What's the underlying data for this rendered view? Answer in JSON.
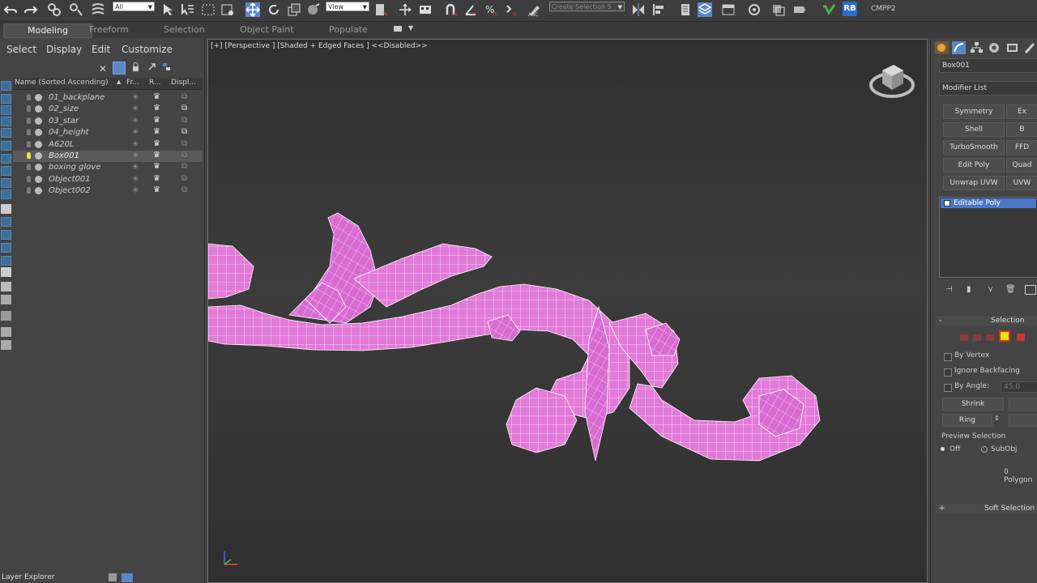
{
  "toolbar": {
    "filter_value": "All",
    "refcoord_value": "View",
    "selection_set_placeholder": "Create Selection S",
    "rb_badge": "RB",
    "right_label": "CMPP2"
  },
  "ribbon": {
    "tabs": [
      "Modeling",
      "Freeform",
      "Selection",
      "Object Paint",
      "Populate"
    ],
    "active_tab": "Modeling"
  },
  "explorer": {
    "menus": [
      "Select",
      "Display",
      "Edit",
      "Customize"
    ],
    "columns": [
      "Name (Sorted Ascending)",
      "Fr...",
      "R...",
      "Displ..."
    ],
    "objects": [
      {
        "name": "01_backplane",
        "selected": false
      },
      {
        "name": "02_size",
        "selected": false
      },
      {
        "name": "03_star",
        "selected": false
      },
      {
        "name": "04_height",
        "selected": false
      },
      {
        "name": "A620L",
        "selected": false
      },
      {
        "name": "Box001",
        "selected": true
      },
      {
        "name": "boxing glove",
        "selected": false
      },
      {
        "name": "Object001",
        "selected": false
      },
      {
        "name": "Object002",
        "selected": false
      }
    ],
    "layer_label": "Layer Explorer"
  },
  "viewport": {
    "label": "[+] [Perspective ] [Shaded + Edged Faces ]  <<Disabled>>",
    "mesh_color": "#e879e0"
  },
  "command_panel": {
    "object_name": "Box001",
    "modifier_list": "Modifier List",
    "modifier_buttons": [
      [
        "Symmetry",
        "Ex"
      ],
      [
        "Shell",
        "B"
      ],
      [
        "TurboSmooth",
        "FFD"
      ],
      [
        "Edit Poly",
        "Quad"
      ],
      [
        "Unwrap UVW",
        "UVW"
      ]
    ],
    "stack_item": "Editable Poly",
    "selection_rollout": "Selection",
    "by_vertex": "By Vertex",
    "ignore_backfacing": "Ignore Backfacing",
    "by_angle": "By Angle:",
    "by_angle_value": "45,0",
    "shrink": "Shrink",
    "ring": "Ring",
    "preview_selection": "Preview Selection",
    "off": "Off",
    "subobj": "SubObj",
    "status": "0 Polygon",
    "soft_selection": "Soft Selection",
    "active_subobj_color": "#f0e000"
  }
}
